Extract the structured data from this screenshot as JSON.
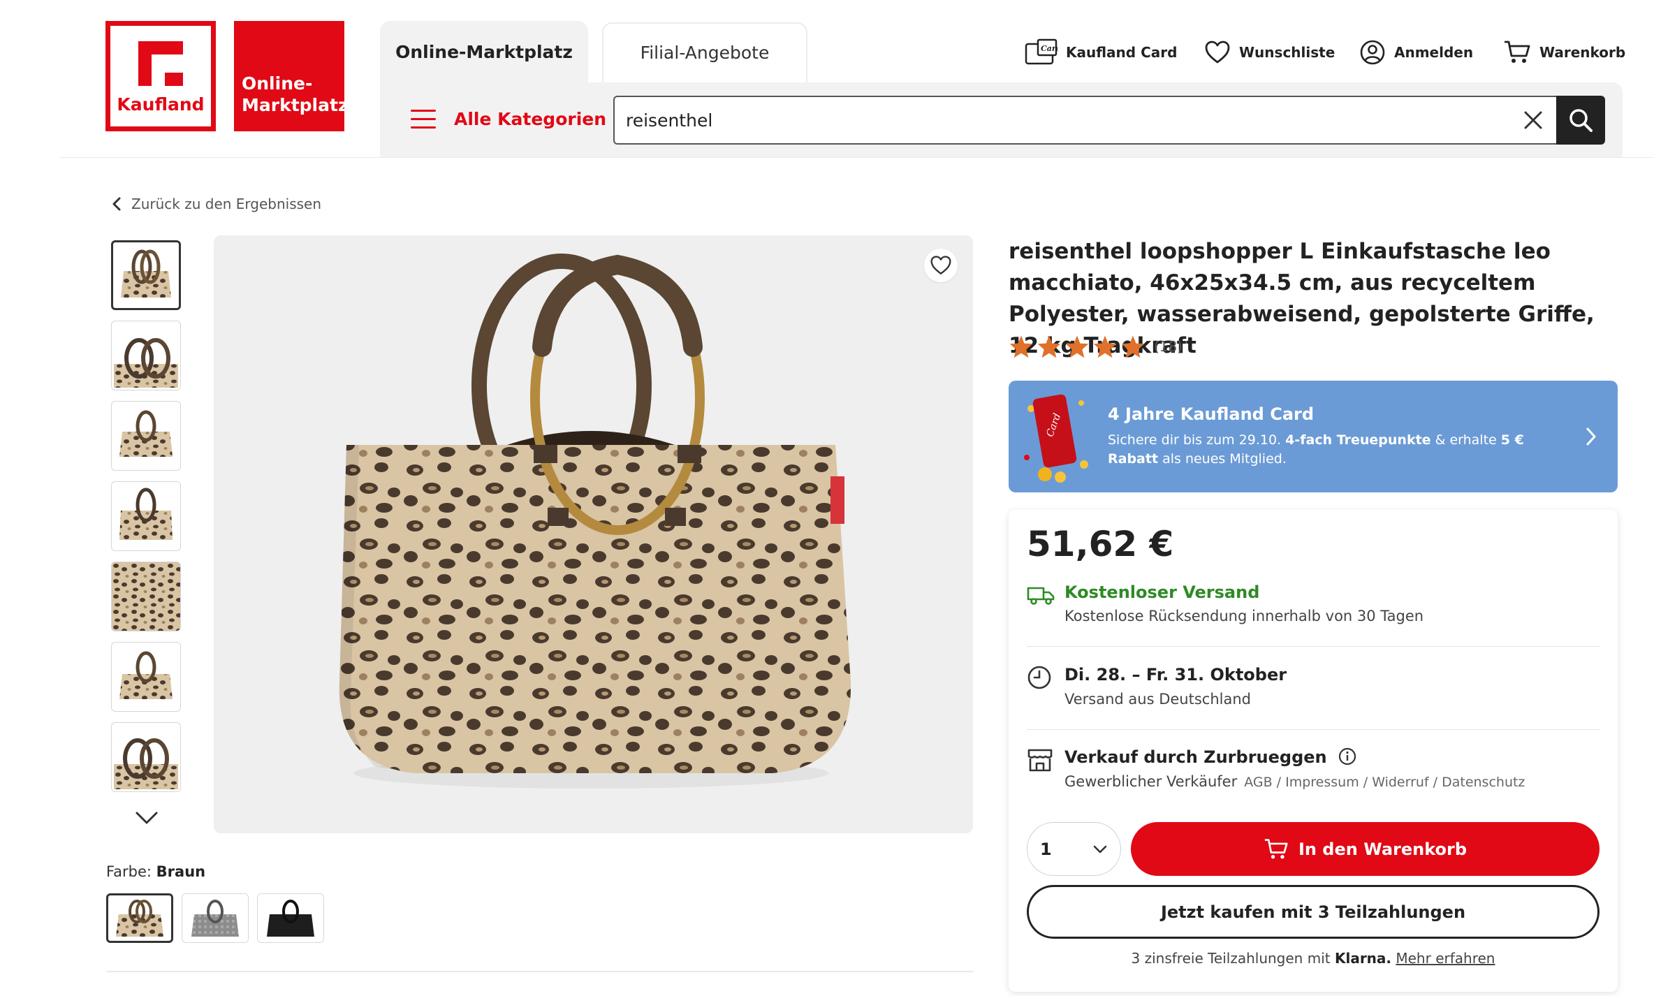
{
  "header": {
    "logo_text": "Kaufland",
    "marketplace_logo_line1": "Online-",
    "marketplace_logo_line2": "Marktplatz",
    "tabs": [
      {
        "label": "Online-Marktplatz",
        "active": true
      },
      {
        "label": "Filial-Angebote",
        "active": false
      }
    ],
    "all_categories": "Alle Kategorien",
    "search_value": "reisenthel",
    "nav": {
      "card": "Kaufland Card",
      "wishlist": "Wunschliste",
      "login": "Anmelden",
      "cart": "Warenkorb"
    }
  },
  "breadcrumb": {
    "back": "Zurück zu den Ergebnissen"
  },
  "gallery": {
    "thumbnail_count": 7,
    "active_index": 0
  },
  "variant": {
    "label": "Farbe:",
    "selected": "Braun",
    "swatch_count": 3
  },
  "product": {
    "title": "reisenthel loopshopper L Einkaufstasche leo macchiato, 46x25x34.5 cm, aus recyceltem Polyester, wasserabwei­send, gepolsterte Griffe, 12 kg Tragkraft",
    "rating_stars": 5,
    "rating_count": "(18)",
    "brand_tag": "reisenthel"
  },
  "promo": {
    "title": "4 Jahre Kaufland Card",
    "text_1": "Sichere dir bis zum 29.10. ",
    "text_bold_1": "4-fach Treuepunkte",
    "text_2": " & erhalte ",
    "text_bold_2": "5 € Rabatt",
    "text_3": " als neues Mitglied."
  },
  "buybox": {
    "price": "51,62 €",
    "shipping_title": "Kostenloser Versand",
    "shipping_sub": "Kostenlose Rücksendung innerhalb von 30 Tagen",
    "delivery_title": "Di. 28. – Fr. 31. Oktober",
    "delivery_sub": "Versand aus Deutschland",
    "seller_title": "Verkauf durch Zurbrueggen",
    "seller_sub": "Gewerblicher Verkäufer",
    "seller_links": "AGB / Impressum / Widerruf / Datenschutz",
    "quantity": "1",
    "add_to_cart": "In den Warenkorb",
    "installments_button": "Jetzt kaufen mit 3 Teilzahlungen",
    "installments_note": "3 zinsfreie Teilzahlungen mit",
    "klarna_brand": "Klarna.",
    "learn_more": "Mehr erfahren"
  },
  "colors": {
    "brand_red": "#e10915",
    "promo_blue": "#6b9bd6",
    "shipping_green": "#2e8a25",
    "star_orange": "#e0702a"
  }
}
